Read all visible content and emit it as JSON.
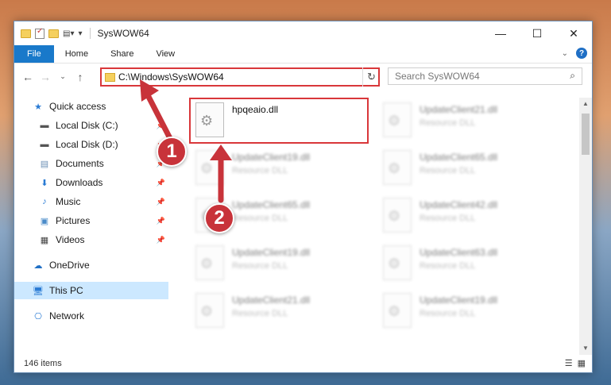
{
  "window": {
    "title": "SysWOW64",
    "minimize_glyph": "—",
    "maximize_glyph": "☐",
    "close_glyph": "✕"
  },
  "ribbon": {
    "tabs": [
      "File",
      "Home",
      "Share",
      "View"
    ],
    "help": "?"
  },
  "address": {
    "path": "C:\\Windows\\SysWOW64",
    "search_placeholder": "Search SysWOW64"
  },
  "sidebar": {
    "items": [
      {
        "label": "Quick access",
        "icon": "star-icon"
      },
      {
        "label": "Local Disk (C:)",
        "icon": "drive-icon"
      },
      {
        "label": "Local Disk (D:)",
        "icon": "drive-icon"
      },
      {
        "label": "Documents",
        "icon": "documents-icon"
      },
      {
        "label": "Downloads",
        "icon": "downloads-icon"
      },
      {
        "label": "Music",
        "icon": "music-icon"
      },
      {
        "label": "Pictures",
        "icon": "pictures-icon"
      },
      {
        "label": "Videos",
        "icon": "videos-icon"
      },
      {
        "label": "OneDrive",
        "icon": "cloud-icon"
      },
      {
        "label": "This PC",
        "icon": "computer-icon"
      },
      {
        "label": "Network",
        "icon": "network-icon"
      }
    ]
  },
  "files": [
    {
      "name": "hpqeaio.dll",
      "type": ""
    },
    {
      "name": "UpdateClient21.dll",
      "type": "Resource DLL"
    },
    {
      "name": "UpdateClient19.dll",
      "type": "Resource DLL"
    },
    {
      "name": "UpdateClient65.dll",
      "type": "Resource DLL"
    },
    {
      "name": "UpdateClient65.dll",
      "type": "Resource DLL"
    },
    {
      "name": "UpdateClient42.dll",
      "type": "Resource DLL"
    },
    {
      "name": "UpdateClient19.dll",
      "type": "Resource DLL"
    },
    {
      "name": "UpdateClient63.dll",
      "type": "Resource DLL"
    },
    {
      "name": "UpdateClient21.dll",
      "type": "Resource DLL"
    },
    {
      "name": "UpdateClient19.dll",
      "type": "Resource DLL"
    }
  ],
  "status": {
    "count": "146 items"
  },
  "callouts": [
    "1",
    "2"
  ],
  "colors": {
    "accent": "#1979ca",
    "highlight": "#d9373a",
    "callout": "#c8333a"
  }
}
